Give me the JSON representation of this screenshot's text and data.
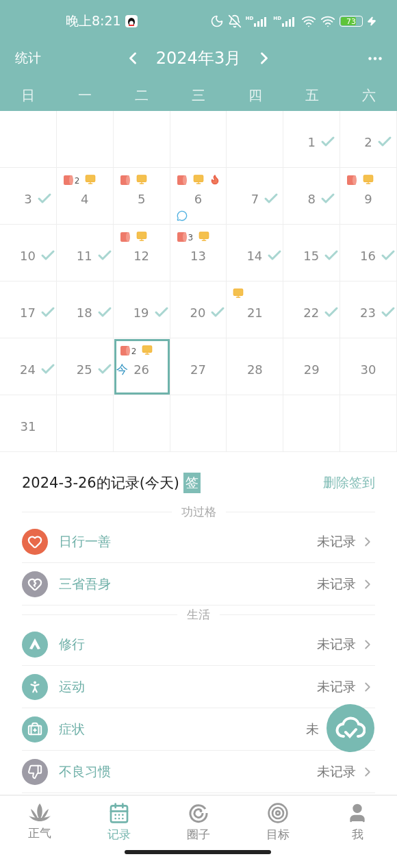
{
  "status_bar": {
    "time": "晚上8:21",
    "signals": [
      {
        "label": "HD"
      },
      {
        "label": "HD"
      }
    ],
    "battery": {
      "reading": "73",
      "level": 0.73,
      "charging": true
    }
  },
  "header": {
    "left": "统计",
    "title": "2024年3月"
  },
  "weekdays": [
    "日",
    "一",
    "二",
    "三",
    "四",
    "五",
    "六"
  ],
  "calendar": {
    "weeks": [
      [
        {
          "kind": "blank"
        },
        {
          "kind": "blank"
        },
        {
          "kind": "blank"
        },
        {
          "kind": "blank"
        },
        {
          "kind": "blank"
        },
        {
          "kind": "day",
          "day": "1",
          "checked": true,
          "selected": false
        },
        {
          "kind": "day",
          "day": "2",
          "checked": true,
          "selected": false
        }
      ],
      [
        {
          "kind": "day",
          "day": "3",
          "checked": true,
          "selected": false
        },
        {
          "kind": "day",
          "day": "4",
          "checked": false,
          "selected": false,
          "marks": [
            {
              "kind": "roll",
              "count": "2"
            },
            {
              "kind": "monitor"
            }
          ]
        },
        {
          "kind": "day",
          "day": "5",
          "checked": false,
          "selected": false,
          "marks": [
            {
              "kind": "roll"
            },
            {
              "kind": "monitor"
            }
          ]
        },
        {
          "kind": "day",
          "day": "6",
          "checked": false,
          "selected": false,
          "marks": [
            {
              "kind": "roll"
            },
            {
              "kind": "monitor"
            },
            {
              "kind": "fire"
            },
            {
              "kind": "comment"
            }
          ]
        },
        {
          "kind": "day",
          "day": "7",
          "checked": true,
          "selected": false
        },
        {
          "kind": "day",
          "day": "8",
          "checked": true,
          "selected": false
        },
        {
          "kind": "day",
          "day": "9",
          "checked": false,
          "selected": false,
          "marks": [
            {
              "kind": "roll"
            },
            {
              "kind": "monitor"
            }
          ]
        }
      ],
      [
        {
          "kind": "day",
          "day": "10",
          "checked": true,
          "selected": false
        },
        {
          "kind": "day",
          "day": "11",
          "checked": true,
          "selected": false
        },
        {
          "kind": "day",
          "day": "12",
          "checked": false,
          "selected": false,
          "marks": [
            {
              "kind": "roll"
            },
            {
              "kind": "monitor"
            }
          ]
        },
        {
          "kind": "day",
          "day": "13",
          "checked": false,
          "selected": false,
          "marks": [
            {
              "kind": "roll",
              "count": "3"
            },
            {
              "kind": "monitor"
            }
          ]
        },
        {
          "kind": "day",
          "day": "14",
          "checked": true,
          "selected": false
        },
        {
          "kind": "day",
          "day": "15",
          "checked": true,
          "selected": false
        },
        {
          "kind": "day",
          "day": "16",
          "checked": true,
          "selected": false
        }
      ],
      [
        {
          "kind": "day",
          "day": "17",
          "checked": true,
          "selected": false
        },
        {
          "kind": "day",
          "day": "18",
          "checked": true,
          "selected": false
        },
        {
          "kind": "day",
          "day": "19",
          "checked": true,
          "selected": false
        },
        {
          "kind": "day",
          "day": "20",
          "checked": true,
          "selected": false
        },
        {
          "kind": "day",
          "day": "21",
          "checked": false,
          "selected": false,
          "marks": [
            {
              "kind": "monitor"
            }
          ]
        },
        {
          "kind": "day",
          "day": "22",
          "checked": true,
          "selected": false
        },
        {
          "kind": "day",
          "day": "23",
          "checked": true,
          "selected": false
        }
      ],
      [
        {
          "kind": "day",
          "day": "24",
          "checked": true,
          "selected": false
        },
        {
          "kind": "day",
          "day": "25",
          "checked": true,
          "selected": false
        },
        {
          "kind": "day",
          "day": "26",
          "checked": false,
          "selected": true,
          "today_label": "今",
          "marks": [
            {
              "kind": "roll",
              "count": "2"
            },
            {
              "kind": "monitor"
            }
          ]
        },
        {
          "kind": "day",
          "day": "27",
          "checked": false,
          "selected": false
        },
        {
          "kind": "day",
          "day": "28",
          "checked": false,
          "selected": false
        },
        {
          "kind": "day",
          "day": "29",
          "checked": false,
          "selected": false
        },
        {
          "kind": "day",
          "day": "30",
          "checked": false,
          "selected": false
        }
      ],
      [
        {
          "kind": "day",
          "day": "31",
          "checked": false,
          "selected": false
        },
        {
          "kind": "blank"
        },
        {
          "kind": "blank"
        },
        {
          "kind": "blank"
        },
        {
          "kind": "blank"
        },
        {
          "kind": "blank"
        },
        {
          "kind": "blank"
        }
      ]
    ]
  },
  "records": {
    "title": "2024-3-26的记录(今天)",
    "badge": "签",
    "action": "删除签到",
    "groups": [
      {
        "title": "功过格",
        "items": [
          {
            "kind": "heart",
            "label": "日行一善",
            "status": "未记录",
            "color": "#e8694a",
            "covered": false
          },
          {
            "kind": "broken-heart",
            "label": "三省吾身",
            "status": "未记录",
            "color": "#9d9ba5",
            "covered": false
          }
        ]
      },
      {
        "title": "生活",
        "items": [
          {
            "kind": "hands",
            "label": "修行",
            "status": "未记录",
            "color": "#7dbcb5",
            "covered": false
          },
          {
            "kind": "runner",
            "label": "运动",
            "status": "未记录",
            "color": "#7dbcb5",
            "covered": false
          },
          {
            "kind": "medkit",
            "label": "症状",
            "status": "未",
            "color": "#7dbcb5",
            "covered": true
          },
          {
            "kind": "thumbs-down",
            "label": "不良习惯",
            "status": "未记录",
            "color": "#9d9ba5",
            "covered": false
          }
        ]
      }
    ]
  },
  "bottom_nav": [
    {
      "kind": "lotus",
      "label": "正气",
      "selected": false
    },
    {
      "kind": "calendar",
      "label": "记录",
      "selected": true
    },
    {
      "kind": "circle",
      "label": "圈子",
      "selected": false
    },
    {
      "kind": "target",
      "label": "目标",
      "selected": false
    },
    {
      "kind": "user",
      "label": "我",
      "selected": false
    }
  ]
}
